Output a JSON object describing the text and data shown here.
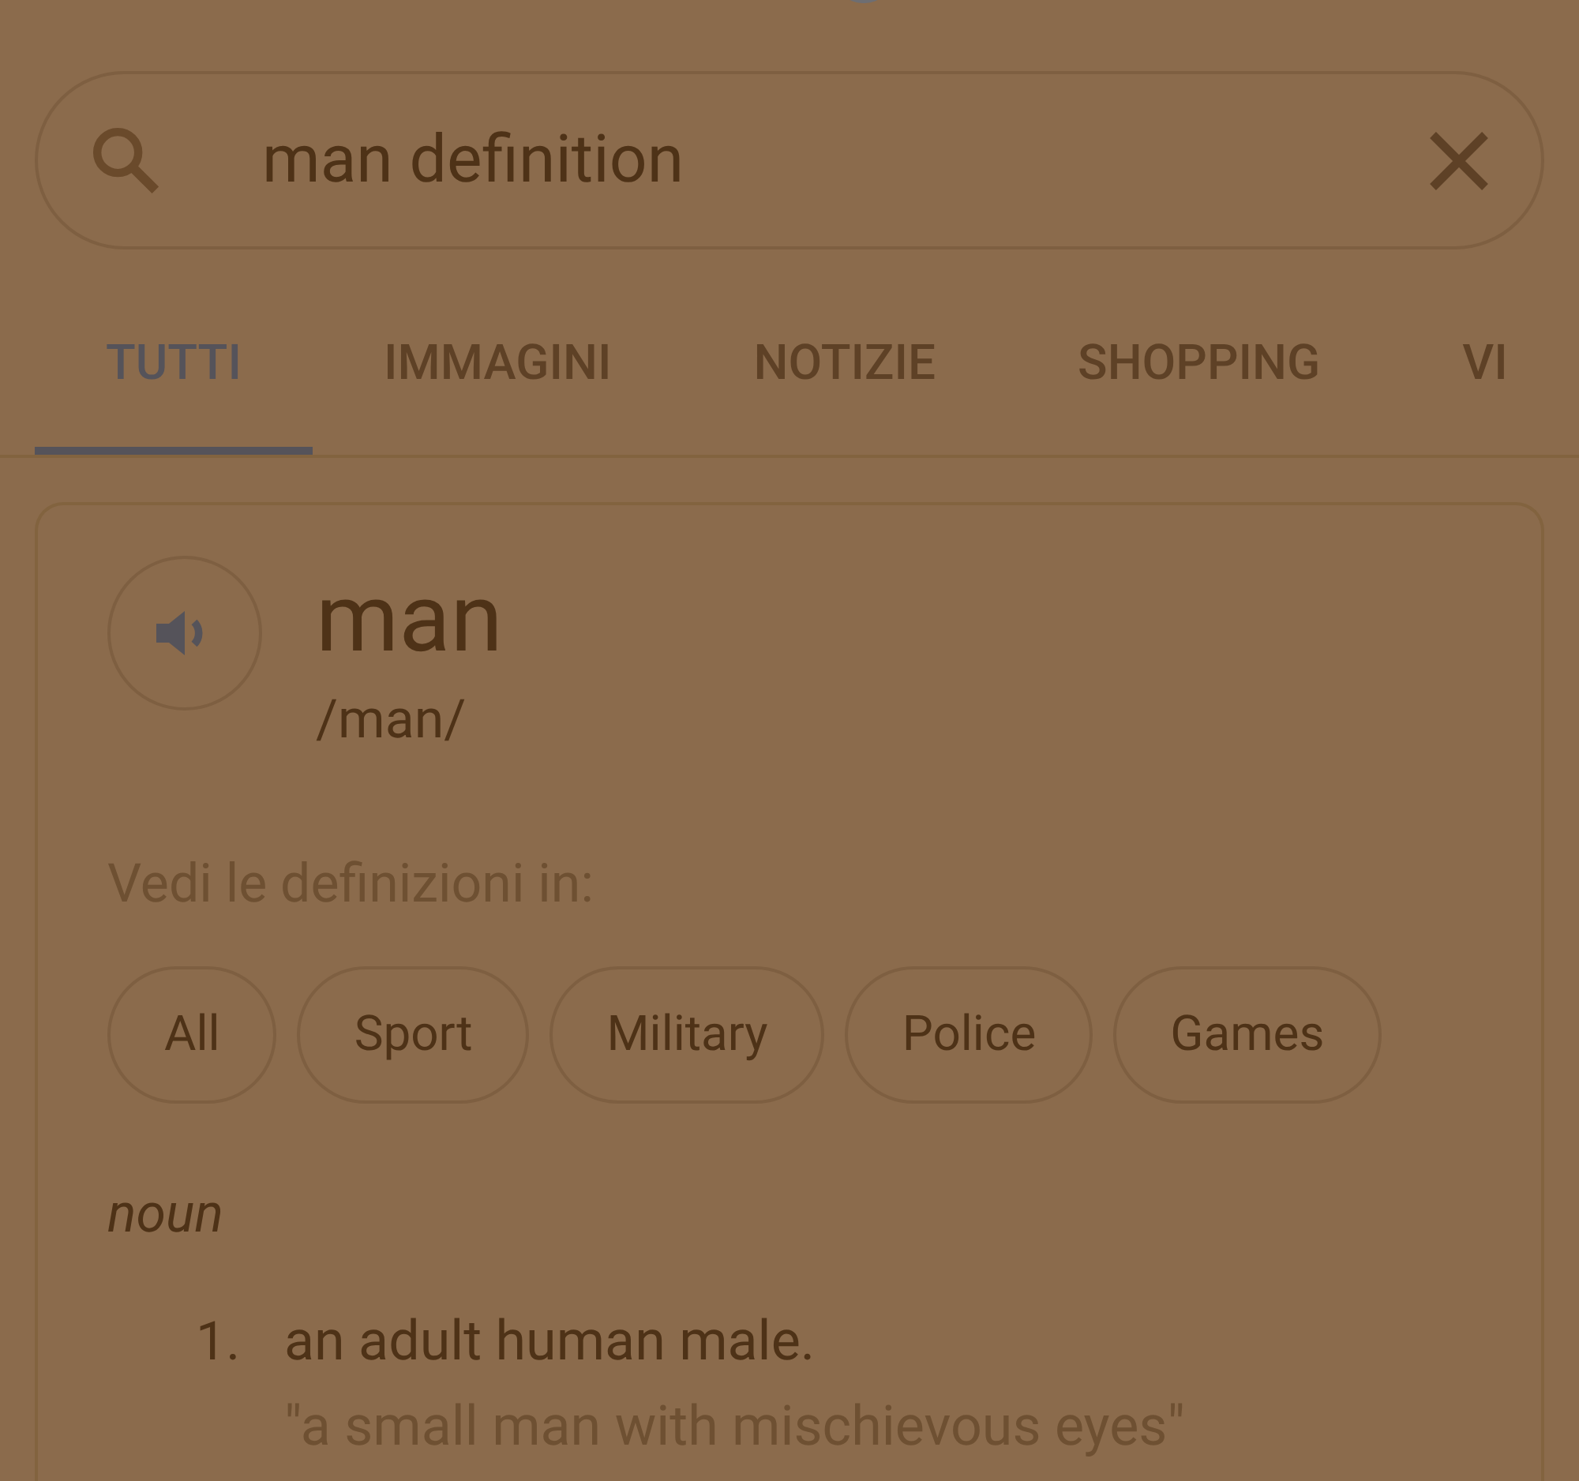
{
  "search": {
    "value": "man definition"
  },
  "tabs": [
    {
      "label": "TUTTI",
      "selected": true
    },
    {
      "label": "IMMAGINI",
      "selected": false
    },
    {
      "label": "NOTIZIE",
      "selected": false
    },
    {
      "label": "SHOPPING",
      "selected": false
    },
    {
      "label": "VI",
      "selected": false
    }
  ],
  "card": {
    "word": "man",
    "pronunciation": "/man/",
    "see_in_label": "Vedi le definizioni in:",
    "chips": [
      "All",
      "Sport",
      "Military",
      "Police",
      "Games"
    ],
    "part_of_speech": "noun",
    "definitions": [
      {
        "number": "1.",
        "text": "an adult human male.",
        "example": "\"a small man with mischievous eyes\""
      }
    ]
  }
}
